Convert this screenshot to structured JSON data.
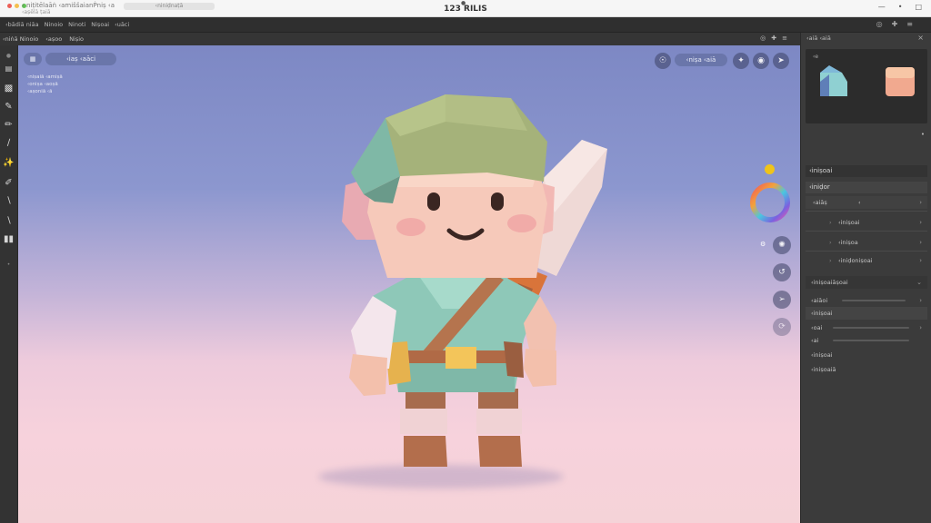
{
  "window": {
    "title": "123 RILIS",
    "doc_name": "‹ niṭitēlaāṅ ‹amiššaianṖniṣ ‹a",
    "doc_sub": "‹aṣēlā ṭaiā",
    "tab_label": "‹niniḍnaṭā",
    "right_icons": [
      "—",
      "•",
      "□"
    ]
  },
  "menubar": {
    "items": [
      "‹bādiā niāa",
      "Ninoio",
      "Ninoti",
      "Niṣoai",
      "‹uāci"
    ],
    "right_icons": [
      "◎",
      "✚",
      "≡"
    ]
  },
  "toolrow": {
    "items": [
      "‹niṅā Ninoio",
      "‹aṣoo",
      "Niṣio"
    ],
    "right_icons": [
      "◎",
      "✚",
      "≡"
    ]
  },
  "viewport": {
    "top_pills": [
      "",
      "‹iaṣ ‹aāci"
    ],
    "info_lines": [
      "‹niṣaiā ‹amiṣā",
      "‹oniṣa ‹aoṣā",
      "‹aṣoniā ‹ā"
    ],
    "right_pill": "‹niṣa ‹aiā"
  },
  "right_panel": {
    "header": "‹aiā ‹aiā",
    "preview_label": "‹e",
    "sections": {
      "modifiers": "‹iniṣoai",
      "material": "‹iniḍor"
    },
    "rows": [
      {
        "label": "‹aiāṣ",
        "value": "‹"
      },
      {
        "label": "‹iniṣoai",
        "value": ""
      },
      {
        "label": "‹iniṣoa",
        "value": ""
      },
      {
        "label": "‹iniḍoniṣoai",
        "value": ""
      }
    ],
    "properties": [
      "‹iniṣoaiāṣoai",
      "‹aiāoi",
      "‹iniṣoai",
      "‹oai",
      "‹ai",
      "‹iniṣoai",
      "‹iniṣoaiā"
    ]
  },
  "colors": {
    "accent_yellow": "#f0c419",
    "ring_start": "#f25a5a",
    "ring_mid": "#4ac6e0",
    "character_skin": "#f2c1b0",
    "character_hat": "#a5b27a",
    "character_tunic": "#8ec8b8"
  }
}
